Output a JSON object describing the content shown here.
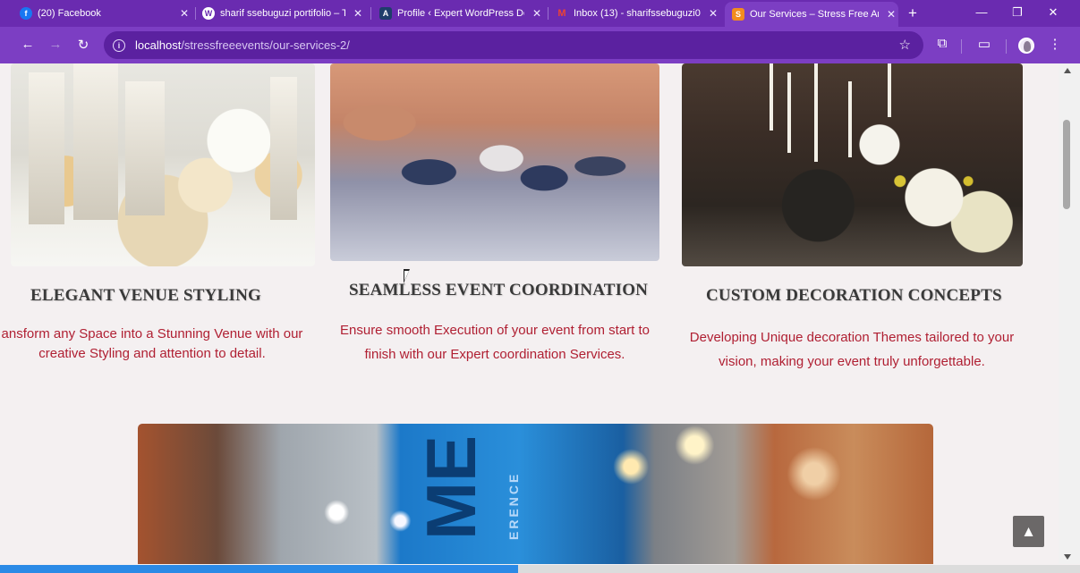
{
  "browser": {
    "tabs": [
      {
        "title": "(20) Facebook",
        "icon": "facebook-icon",
        "color": "#1877f2",
        "glyph": "f"
      },
      {
        "title": "sharif ssebuguzi portifolio – T",
        "icon": "wordpress-icon",
        "color": "#ffffff",
        "glyph": "W"
      },
      {
        "title": "Profile ‹ Expert WordPress De",
        "icon": "profile-site-icon",
        "color": "#1f3d6b",
        "glyph": "A"
      },
      {
        "title": "Inbox (13) - sharifssebuguzi0",
        "icon": "gmail-icon",
        "color": "#ea4335",
        "glyph": "M"
      },
      {
        "title": "Our Services – Stress Free An",
        "icon": "site-logo-icon",
        "color": "#f28c1f",
        "glyph": "S"
      }
    ],
    "active_tab_index": 4,
    "url_host": "localhost",
    "url_path": "/stressfreeevents/our-services-2/",
    "new_tab_label": "+",
    "window_controls": {
      "minimize": "—",
      "restore": "❐",
      "close": "✕"
    }
  },
  "services": [
    {
      "title": "ELEGANT VENUE STYLING",
      "description": "ansform any Space into a Stunning Venue with our creative Styling and attention to detail.",
      "image": "venue-styling-photo"
    },
    {
      "title": "SEAMLESS EVENT COORDINATION",
      "description": "Ensure smooth Execution of your event from start to finish with our Expert coordination Services.",
      "image": "event-coordination-photo"
    },
    {
      "title": "CUSTOM DECORATION CONCEPTS",
      "description": "Developing Unique decoration Themes tailored to your vision, making your event truly unforgettable.",
      "image": "decoration-concepts-photo"
    }
  ],
  "banner": {
    "text": "ME",
    "subtext": "ERENCE"
  },
  "back_to_top_label": "▲",
  "page_load_progress": 0.48
}
